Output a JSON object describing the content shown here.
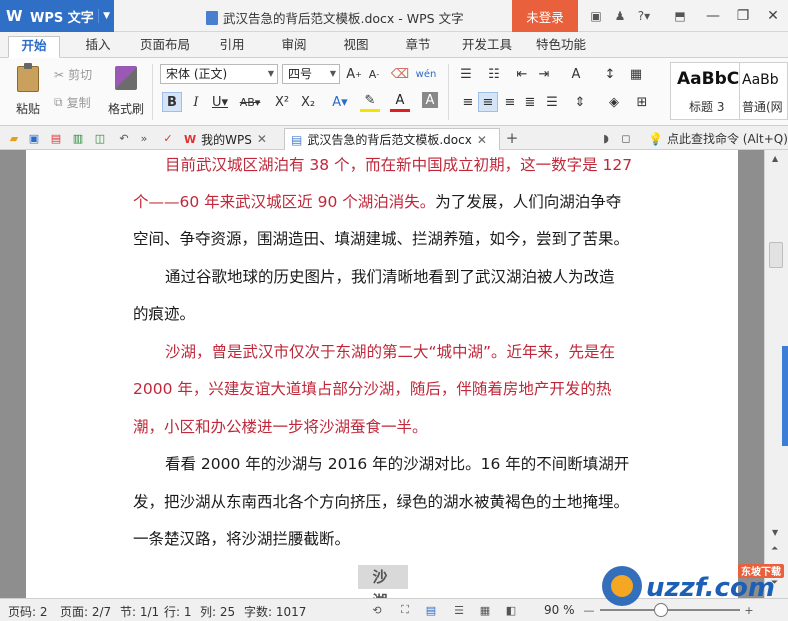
{
  "titlebar": {
    "app_name": "WPS 文字",
    "doc_title": "武汉告急的背后范文模板.docx - WPS 文字",
    "login_label": "未登录",
    "icons": [
      "skin-icon",
      "shirt-icon",
      "help-icon",
      "fullscreen-icon"
    ]
  },
  "menu": {
    "tabs": [
      {
        "label": "开始",
        "active": true
      },
      {
        "label": "插入"
      },
      {
        "label": "页面布局"
      },
      {
        "label": "引用"
      },
      {
        "label": "审阅"
      },
      {
        "label": "视图"
      },
      {
        "label": "章节"
      },
      {
        "label": "开发工具"
      },
      {
        "label": "特色功能"
      }
    ]
  },
  "ribbon": {
    "paste_label": "粘贴",
    "cut_label": "剪切",
    "copy_label": "复制",
    "format_brush_label": "格式刷",
    "font_name": "宋体 (正文)",
    "font_size": "四号",
    "styles": [
      {
        "sample": "AaBbC",
        "name": "标题 3"
      },
      {
        "sample": "AaBb",
        "name": "普通(网"
      }
    ]
  },
  "tabs": {
    "items": [
      {
        "label": "我的WPS"
      },
      {
        "label": "武汉告急的背后范文模板.docx",
        "active": true
      }
    ],
    "search_cmd": "点此查找命令 (Alt+Q)"
  },
  "document": {
    "p1_red": "目前武汉城区湖泊有 38 个，而在新中国成立初期，这一数字是 127",
    "p1_red2": "个——60 年来武汉城区近 90 个湖泊消失。",
    "p1_tail": "为了发展，人们向湖泊争夺",
    "p1_line3": "空间、争夺资源，围湖造田、填湖建城、拦湖养殖，如今，尝到了苦果。",
    "p2_line1": "通过谷歌地球的历史图片，我们清晰地看到了武汉湖泊被人为改造",
    "p2_line2": "的痕迹。",
    "p3_line1": "沙湖，曾是武汉市仅次于东湖的第二大“城中湖”。近年来，先是在",
    "p3_line2": "2000 年，兴建友谊大道填占部分沙湖，随后，伴随着房地产开发的热",
    "p3_line3": "潮，小区和办公楼进一步将沙湖蚕食一半。",
    "p4_line1": "看看 2000 年的沙湖与 2016 年的沙湖对比。16 年的不间断填湖开",
    "p4_line2": "发，把沙湖从东南西北各个方向挤压，绿色的湖水被黄褐色的土地掩埋。",
    "p4_line3": "一条楚汉路，将沙湖拦腰截断。",
    "heading": "沙 湖"
  },
  "status": {
    "page_no": "页码: 2",
    "pages": "页面: 2/7",
    "section": "节: 1/1",
    "row": "行: 1",
    "col": "列: 25",
    "word_count": "字数: 1017",
    "zoom": "90 %"
  },
  "watermark": {
    "brand": "uzzf.com",
    "tag": "东坡下载"
  }
}
